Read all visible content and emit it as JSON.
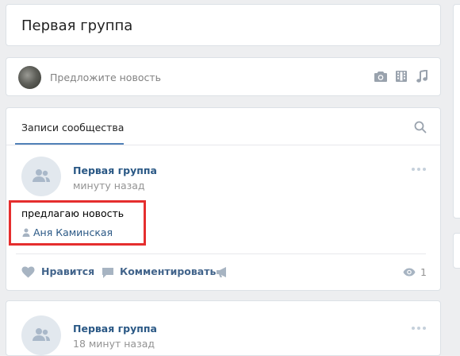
{
  "header": {
    "title": "Первая группа"
  },
  "suggest": {
    "placeholder": "Предложите новость"
  },
  "posts": {
    "tab_label": "Записи сообщества",
    "items": [
      {
        "author": "Первая группа",
        "time": "минуту назад",
        "text": "предлагаю новость",
        "signer": "Аня Каминская",
        "like_label": "Нравится",
        "comment_label": "Комментировать",
        "views": "1"
      },
      {
        "author": "Первая группа",
        "time": "18 минут назад"
      }
    ]
  },
  "colors": {
    "accent": "#5181b8",
    "link": "#2a5885",
    "highlight": "#e52e2e",
    "background": "#edeef0"
  },
  "icons": [
    "camera-icon",
    "video-icon",
    "music-icon",
    "search-icon",
    "group-icon",
    "more-icon",
    "user-icon",
    "heart-icon",
    "comment-icon",
    "share-icon",
    "eye-icon"
  ]
}
